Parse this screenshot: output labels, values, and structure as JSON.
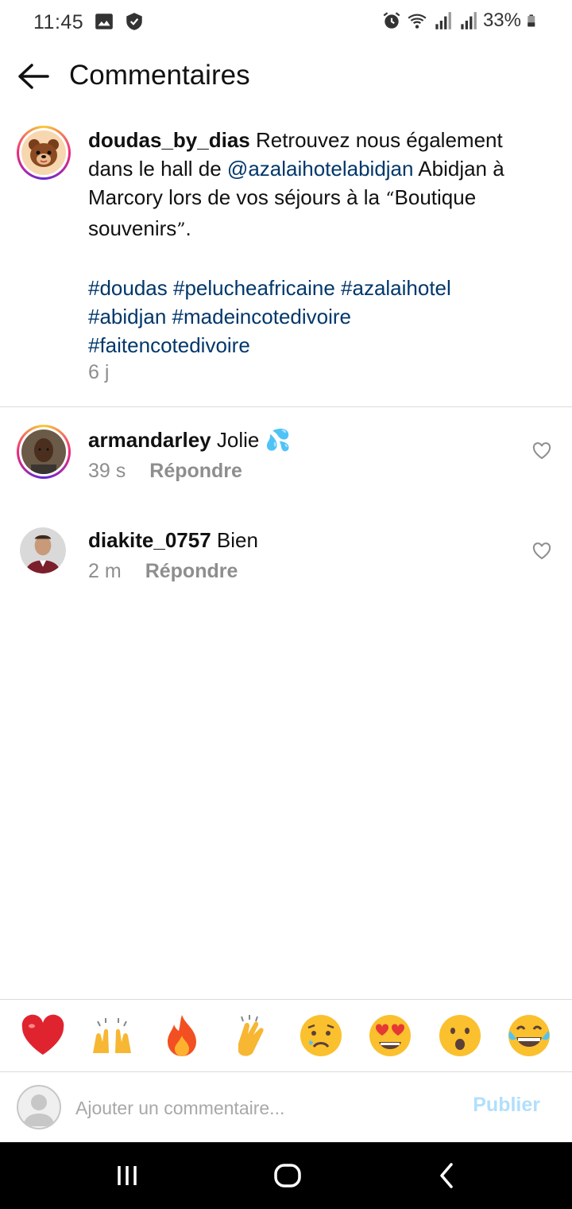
{
  "status_bar": {
    "time": "11:45",
    "battery": "33%",
    "left_icons": [
      "image-icon",
      "shield-icon"
    ],
    "right_icons": [
      "alarm-icon",
      "wifi-icon",
      "signal-icon",
      "signal-icon",
      "battery-icon"
    ]
  },
  "header": {
    "title": "Commentaires",
    "back_icon": "arrow-left-icon"
  },
  "caption": {
    "username": "doudas_by_dias",
    "text_1": "Retrouvez nous également dans le hall de",
    "mention": "@azalaihotelabidjan",
    "text_2": "Abidjan à Marcory lors de vos séjours à la",
    "open_quote": "“",
    "quoted": "Boutique souvenirs",
    "close_quote": "”",
    "text_end": ".",
    "hashtags_line1": "#doudas #pelucheafricaine #azalaihotel",
    "hashtags_line2": "#abidjan #madeincotedivoire",
    "hashtags_line3": "#faitencotedivoire",
    "time": "6 j"
  },
  "comments": [
    {
      "username": "armandarley",
      "text": "Jolie 💦",
      "time": "39 s",
      "reply": "Répondre"
    },
    {
      "username": "diakite_0757",
      "text": "Bien",
      "time": "2 m",
      "reply": "Répondre"
    }
  ],
  "reactions": [
    "❤️",
    "🙌",
    "🔥",
    "👏",
    "😢",
    "😍",
    "😮",
    "😂"
  ],
  "composer": {
    "placeholder": "Ajouter un commentaire...",
    "publish": "Publier"
  },
  "colors": {
    "link": "#00376b",
    "secondary_text": "#8e8e8e",
    "publish_disabled": "#b2dffc",
    "divider": "#dbdbdb"
  }
}
